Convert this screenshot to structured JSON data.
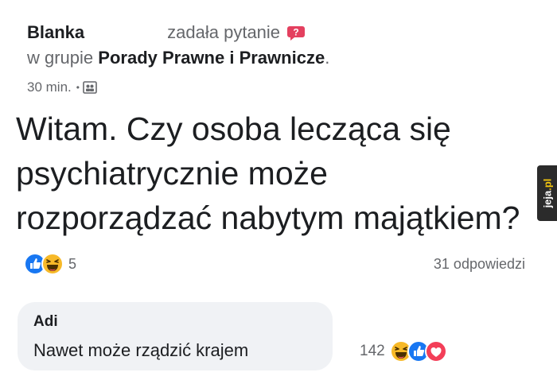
{
  "post": {
    "author": "Blanka",
    "action": "zadała pytanie",
    "group_prefix": "w grupie",
    "group_name": "Porady Prawne i Prawnicze",
    "group_suffix": ".",
    "time": "30 min.",
    "separator": "•",
    "question_lines": [
      "Witam. Czy osoba lecząca się",
      "psychiatrycznie może",
      "rozporządzać nabytym majątkiem?"
    ],
    "reaction_count": "5",
    "answers_count": "31 odpowiedzi",
    "reaction_icons": [
      "like-icon",
      "haha-icon"
    ]
  },
  "comment": {
    "author": "Adi",
    "text": "Nawet może rządzić krajem",
    "reaction_count": "142",
    "reaction_icons": [
      "haha-icon",
      "like-icon",
      "love-icon"
    ]
  },
  "watermark": {
    "name": "jeja",
    "tld": ".pl"
  },
  "colors": {
    "secondary_text": "#65676b",
    "primary_text": "#1c1e21",
    "like_blue": "#1877f2",
    "haha_yellow": "#f7b928",
    "love_red": "#f33e58",
    "question_badge": "#e4405f",
    "comment_bg": "#f0f2f5"
  }
}
